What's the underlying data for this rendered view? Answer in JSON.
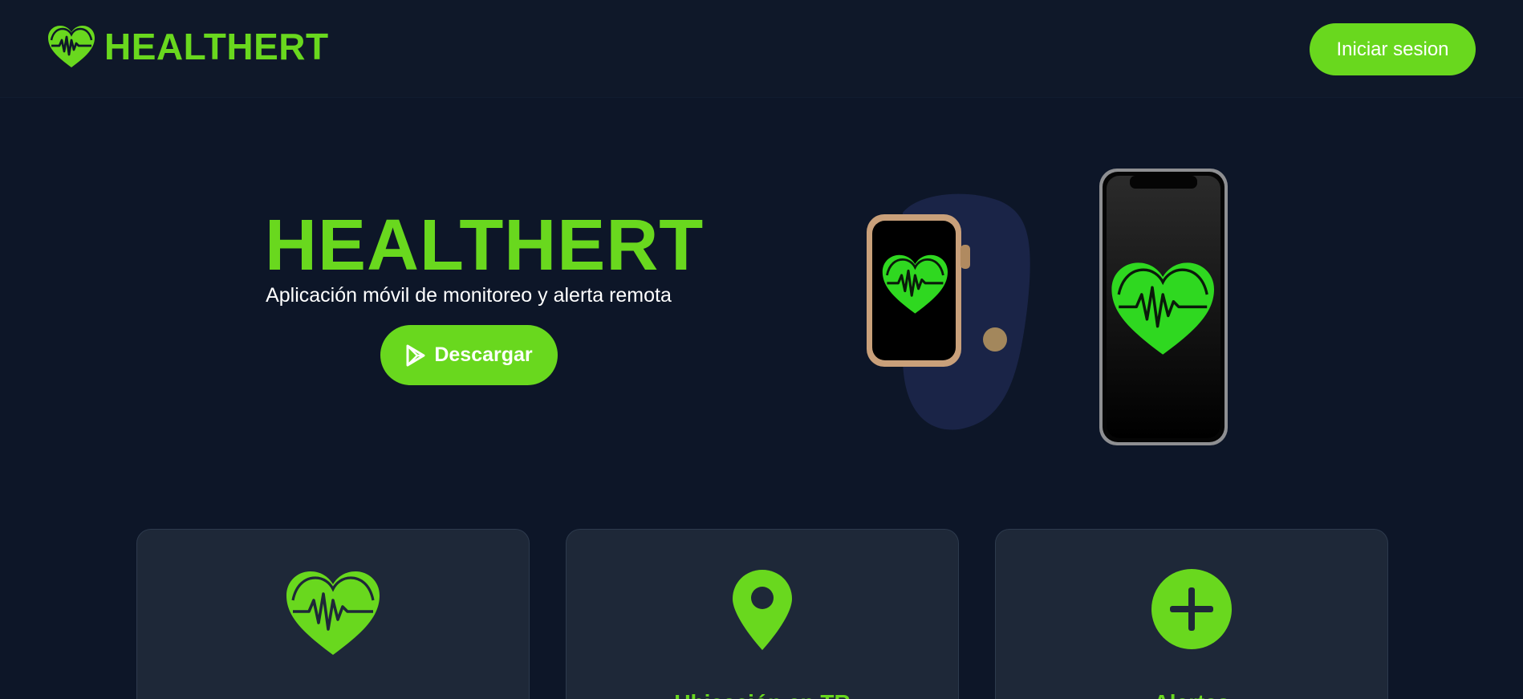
{
  "header": {
    "brand_name": "HEALTHERT",
    "brand_icon": "heart-pulse-icon",
    "login_label": "Iniciar sesion"
  },
  "hero": {
    "title": "HEALTHERT",
    "subtitle": "Aplicación móvil de monitoreo y alerta remota",
    "download_label": "Descargar",
    "download_icon": "play-store-icon"
  },
  "features": [
    {
      "icon": "heart-pulse-icon",
      "title": ""
    },
    {
      "icon": "location-pin-icon",
      "title": "Ubicación en TR"
    },
    {
      "icon": "plus-circle-icon",
      "title": "Alertas"
    }
  ],
  "colors": {
    "accent": "#69d81e",
    "background": "#0d1628",
    "card": "#1e2838",
    "text": "#ffffff"
  }
}
